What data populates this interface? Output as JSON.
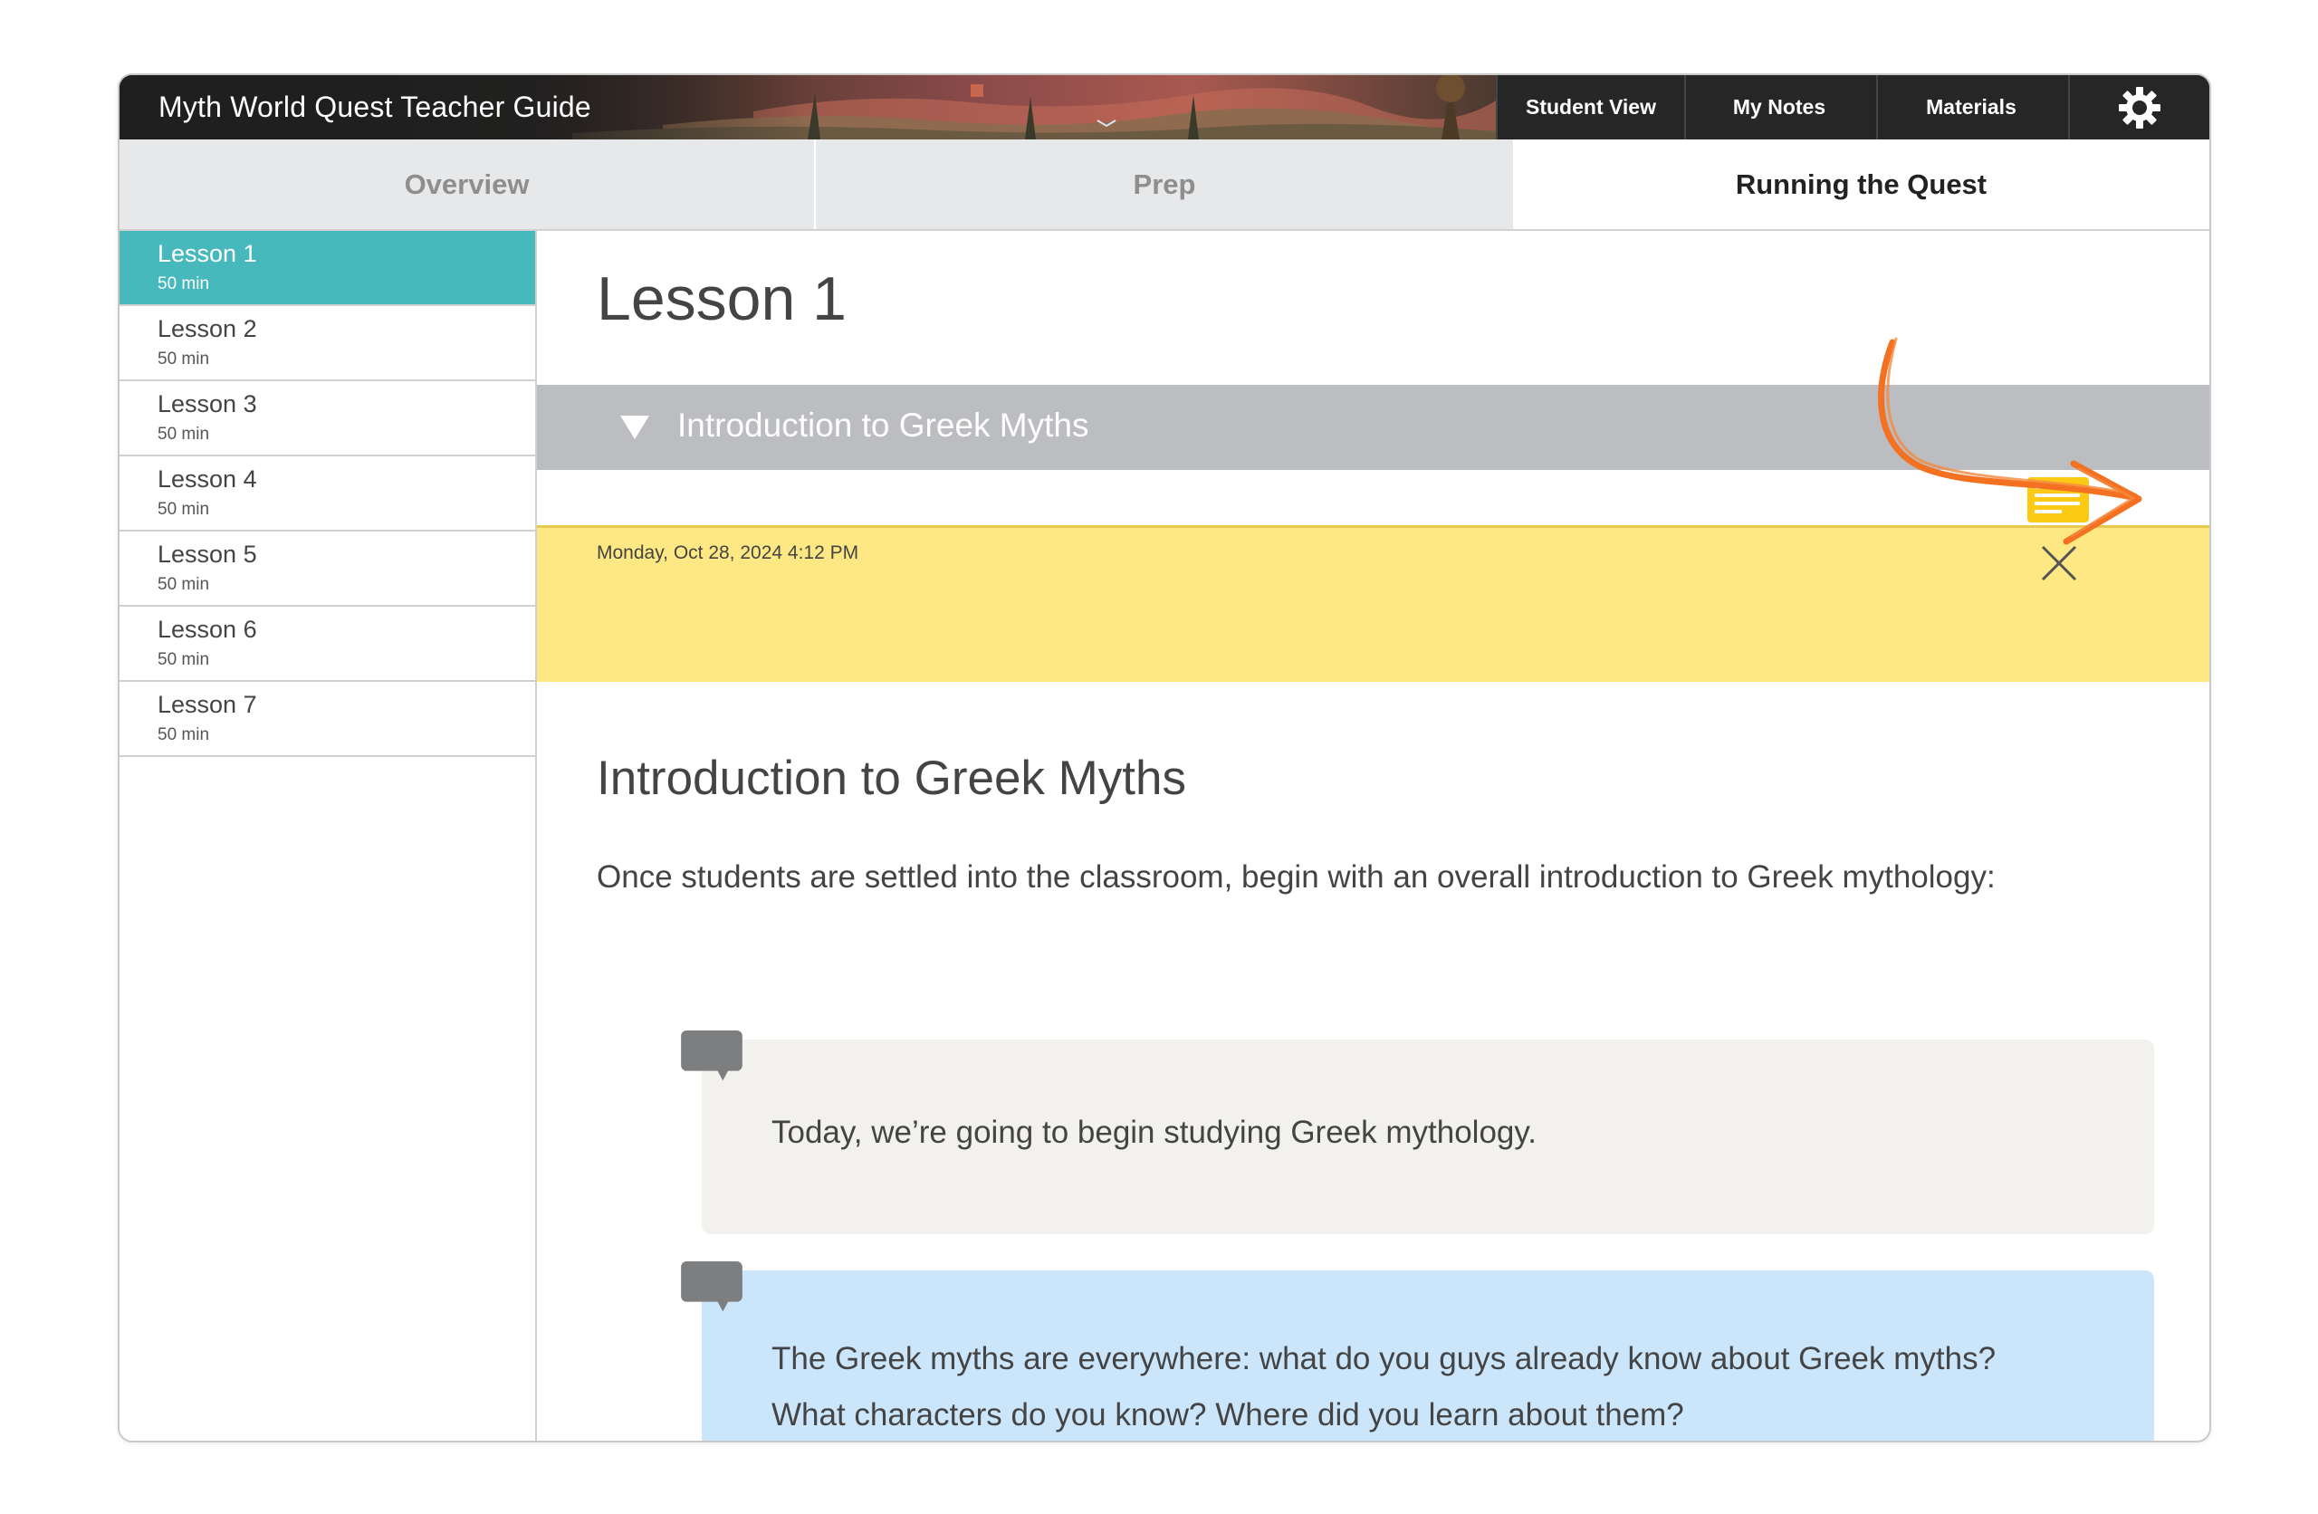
{
  "header": {
    "app_title": "Myth World Quest Teacher Guide",
    "buttons": {
      "student_view": "Student View",
      "my_notes": "My Notes",
      "materials": "Materials"
    },
    "settings_icon": "gear-icon"
  },
  "tabs": [
    {
      "label": "Overview",
      "active": false
    },
    {
      "label": "Prep",
      "active": false
    },
    {
      "label": "Running the Quest",
      "active": true
    }
  ],
  "sidebar": {
    "lessons": [
      {
        "name": "Lesson 1",
        "duration": "50 min",
        "active": true
      },
      {
        "name": "Lesson 2",
        "duration": "50 min",
        "active": false
      },
      {
        "name": "Lesson 3",
        "duration": "50 min",
        "active": false
      },
      {
        "name": "Lesson 4",
        "duration": "50 min",
        "active": false
      },
      {
        "name": "Lesson 5",
        "duration": "50 min",
        "active": false
      },
      {
        "name": "Lesson 6",
        "duration": "50 min",
        "active": false
      },
      {
        "name": "Lesson 7",
        "duration": "50 min",
        "active": false
      }
    ]
  },
  "main": {
    "lesson_title": "Lesson 1",
    "section": {
      "title": "Introduction to Greek Myths",
      "expanded": true
    },
    "note": {
      "timestamp": "Monday, Oct 28, 2024 4:12 PM",
      "text": ""
    },
    "content_heading": "Introduction to Greek Myths",
    "content_paragraph": "Once students are settled into the classroom, begin with an overall introduction to Greek mythology:",
    "speech_1": "Today, we’re going to begin studying Greek mythology.",
    "speech_2_line_1": "The Greek myths are everywhere: what do you guys already know about Greek myths?",
    "speech_2_line_2": "What characters do you know? Where did you learn about them?"
  },
  "colors": {
    "topbar": "#252525",
    "active_lesson": "#47b8bc",
    "section_bar": "#bcbdc0",
    "note_panel": "#fde883",
    "note_icon": "#fcc914",
    "speech_neutral": "#f2f1ee",
    "speech_blue": "#cbe6fb",
    "annotation_arrow": "#f37121"
  }
}
